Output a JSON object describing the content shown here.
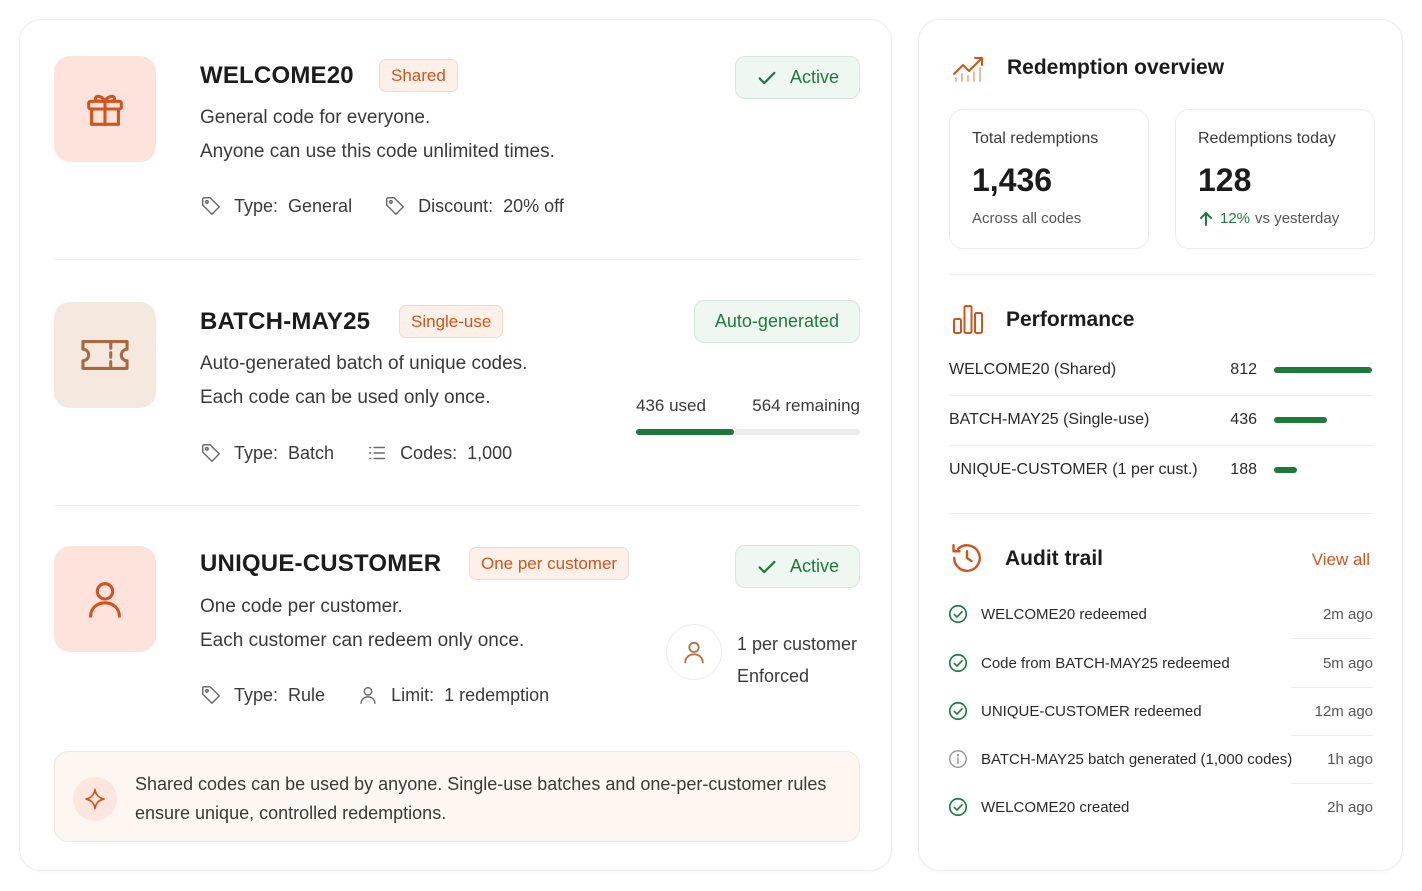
{
  "codes": [
    {
      "name": "WELCOME20",
      "tag": "Shared",
      "status": "Active",
      "desc1": "General code for everyone.",
      "desc2": "Anyone can use this code unlimited times.",
      "meta1_label": "Type:",
      "meta1_value": "General",
      "meta2_label": "Discount:",
      "meta2_value": "20% off"
    },
    {
      "name": "BATCH-MAY25",
      "tag": "Single-use",
      "status": "Auto-generated",
      "desc1": "Auto-generated batch of unique codes.",
      "desc2": "Each code can be used only once.",
      "meta1_label": "Type:",
      "meta1_value": "Batch",
      "meta2_label": "Codes:",
      "meta2_value": "1,000",
      "used_label": "436 used",
      "remaining_label": "564 remaining",
      "used_fraction": 0.436
    },
    {
      "name": "UNIQUE-CUSTOMER",
      "tag": "One per customer",
      "status": "Active",
      "desc1": "One code per customer.",
      "desc2": "Each customer can redeem only once.",
      "meta1_label": "Type:",
      "meta1_value": "Rule",
      "meta2_label": "Limit:",
      "meta2_value": "1 redemption",
      "enforce_line1": "1 per customer",
      "enforce_line2": "Enforced"
    }
  ],
  "note": "Shared codes can be used by anyone. Single-use batches and one-per-customer rules ensure unique, controlled redemptions.",
  "overview": {
    "title": "Redemption overview",
    "total_label": "Total redemptions",
    "total_value": "1,436",
    "total_sub": "Across all codes",
    "today_label": "Redemptions today",
    "today_value": "128",
    "today_change": "12%",
    "today_sub": "vs yesterday"
  },
  "performance": {
    "title": "Performance",
    "max": 812,
    "rows": [
      {
        "name": "WELCOME20 (Shared)",
        "value": "812",
        "count": 812
      },
      {
        "name": "BATCH-MAY25 (Single-use)",
        "value": "436",
        "count": 436
      },
      {
        "name": "UNIQUE-CUSTOMER (1 per cust.)",
        "value": "188",
        "count": 188
      }
    ]
  },
  "audit": {
    "title": "Audit trail",
    "view_all": "View all",
    "rows": [
      {
        "text": "WELCOME20 redeemed",
        "time": "2m ago",
        "icon": "check-circle-icon"
      },
      {
        "text": "Code from BATCH-MAY25 redeemed",
        "time": "5m ago",
        "icon": "check-circle-icon"
      },
      {
        "text": "UNIQUE-CUSTOMER redeemed",
        "time": "12m ago",
        "icon": "check-circle-icon"
      },
      {
        "text": "BATCH-MAY25 batch generated (1,000 codes)",
        "time": "1h ago",
        "icon": "info-circle-icon"
      },
      {
        "text": "WELCOME20 created",
        "time": "2h ago",
        "icon": "check-circle-icon"
      }
    ]
  },
  "colors": {
    "accent": "#d2541c",
    "success": "#1e7a3b",
    "tile_orange": "#fde3dc",
    "tile_beige": "#f4e8df"
  }
}
